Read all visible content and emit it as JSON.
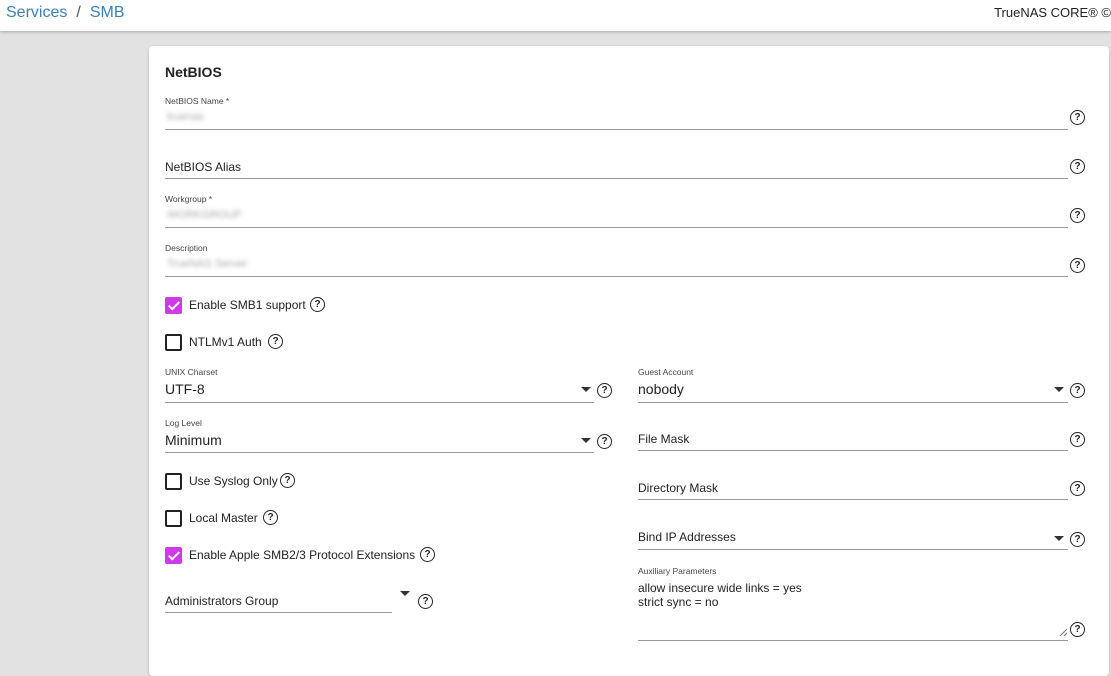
{
  "breadcrumb": {
    "services": "Services",
    "separator": "/",
    "current": "SMB"
  },
  "brand": "TrueNAS CORE® ©",
  "section_title": "NetBIOS",
  "fields": {
    "netbios_name": {
      "label": "NetBIOS Name *",
      "value": "truenas"
    },
    "netbios_alias": {
      "placeholder": "NetBIOS Alias"
    },
    "workgroup": {
      "label": "Workgroup *",
      "value": "WORKGROUP"
    },
    "description": {
      "label": "Description",
      "value": "TrueNAS Server"
    },
    "unix_charset": {
      "label": "UNIX Charset",
      "value": "UTF-8"
    },
    "log_level": {
      "label": "Log Level",
      "value": "Minimum"
    },
    "administrators_group": {
      "placeholder": "Administrators Group"
    },
    "guest_account": {
      "label": "Guest Account",
      "value": "nobody"
    },
    "file_mask": {
      "placeholder": "File Mask"
    },
    "directory_mask": {
      "placeholder": "Directory Mask"
    },
    "bind_ip": {
      "placeholder": "Bind IP Addresses"
    },
    "auxiliary": {
      "label": "Auxiliary Parameters",
      "value": "allow insecure wide links = yes\nstrict sync = no"
    }
  },
  "checkboxes": {
    "smb1": {
      "label": "Enable SMB1 support",
      "checked": true
    },
    "ntlmv1": {
      "label": "NTLMv1 Auth",
      "checked": false
    },
    "syslog": {
      "label": "Use Syslog Only",
      "checked": false
    },
    "local_master": {
      "label": "Local Master",
      "checked": false
    },
    "apple_ext": {
      "label": "Enable Apple SMB2/3 Protocol Extensions",
      "checked": true
    }
  },
  "help_glyph": "?",
  "icons": {
    "help": "help-circle-icon",
    "dropdown": "dropdown-arrow-icon",
    "checkbox": "check-icon"
  },
  "colors": {
    "accent": "#cf39e7",
    "link": "#3a80b5",
    "background": "#e2e2e2"
  }
}
